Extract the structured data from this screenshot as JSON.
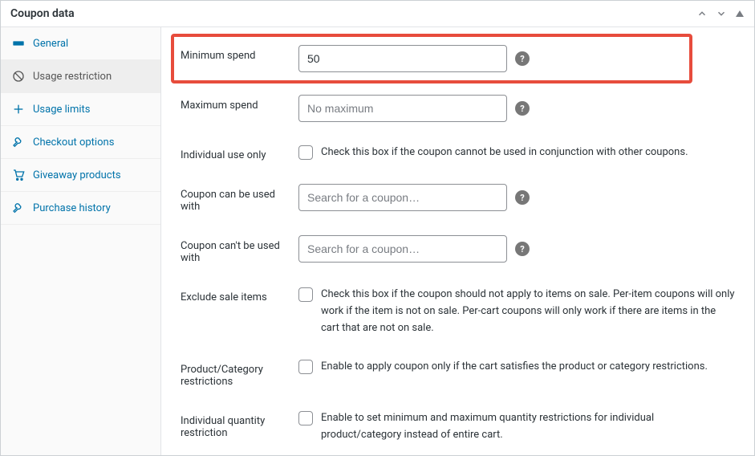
{
  "panel": {
    "title": "Coupon data"
  },
  "tabs": [
    {
      "label": "General"
    },
    {
      "label": "Usage restriction"
    },
    {
      "label": "Usage limits"
    },
    {
      "label": "Checkout options"
    },
    {
      "label": "Giveaway products"
    },
    {
      "label": "Purchase history"
    }
  ],
  "fields": {
    "min_spend": {
      "label": "Minimum spend",
      "value": "50"
    },
    "max_spend": {
      "label": "Maximum spend",
      "placeholder": "No maximum"
    },
    "individual_use": {
      "label": "Individual use only",
      "text": "Check this box if the coupon cannot be used in conjunction with other coupons."
    },
    "used_with": {
      "label": "Coupon can be used with",
      "placeholder": "Search for a coupon…"
    },
    "not_used_with": {
      "label": "Coupon can't be used with",
      "placeholder": "Search for a coupon…"
    },
    "exclude_sale": {
      "label": "Exclude sale items",
      "text": "Check this box if the coupon should not apply to items on sale. Per-item coupons will only work if the item is not on sale. Per-cart coupons will only work if there are items in the cart that are not on sale."
    },
    "prod_cat": {
      "label": "Product/Category restrictions",
      "text": "Enable to apply coupon only if the cart satisfies the product or category restrictions."
    },
    "ind_qty": {
      "label": "Individual quantity restriction",
      "text": "Enable to set minimum and maximum quantity restrictions for individual product/category instead of entire cart."
    }
  }
}
